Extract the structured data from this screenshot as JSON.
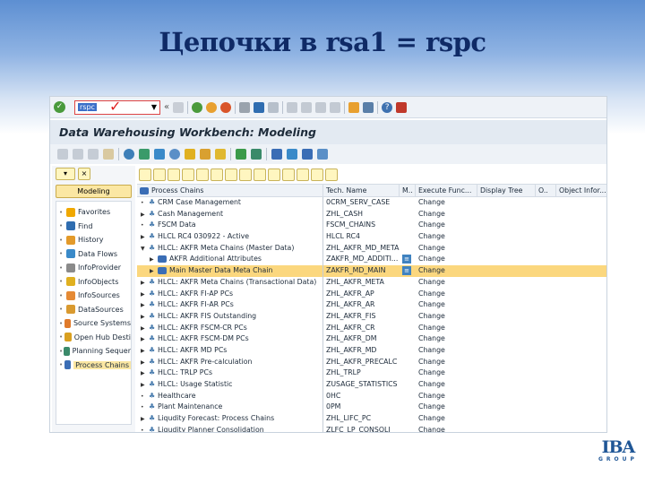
{
  "slide": {
    "title": "Цепочки в rsa1 = rspc",
    "logo": {
      "name": "IBA",
      "sub": "GROUP"
    }
  },
  "toolbar": {
    "command_value": "rspc",
    "check_mark": "✓"
  },
  "window": {
    "title": "Data Warehousing Workbench: Modeling"
  },
  "left": {
    "modeling_label": "Modeling",
    "items": [
      {
        "label": "Favorites",
        "color": "#f0a800"
      },
      {
        "label": "Find",
        "color": "#2f6db0"
      },
      {
        "label": "History",
        "color": "#e39a2a"
      },
      {
        "label": "Data Flows",
        "color": "#3a8ac9"
      },
      {
        "label": "InfoProvider",
        "color": "#8a8a8a"
      },
      {
        "label": "InfoObjects",
        "color": "#e0b020"
      },
      {
        "label": "InfoSources",
        "color": "#e58a35"
      },
      {
        "label": "DataSources",
        "color": "#d99a30"
      },
      {
        "label": "Source Systems",
        "color": "#e07a2a"
      },
      {
        "label": "Open Hub Desti",
        "color": "#d9a020"
      },
      {
        "label": "Planning Sequer",
        "color": "#3a8a6a"
      },
      {
        "label": "Process Chains",
        "color": "#3a6db5",
        "selected": true
      }
    ]
  },
  "tree": {
    "columns": [
      "Process Chains",
      "Tech. Name",
      "M..",
      "Execute Func...",
      "Display Tree",
      "O..",
      "Object Infor..."
    ],
    "rows": [
      {
        "name": "CRM Case Management",
        "tech": "0CRM_SERV_CASE",
        "exec": "Change",
        "expander": "leaf",
        "level": 0
      },
      {
        "name": "Cash Management",
        "tech": "ZHL_CASH",
        "exec": "Change",
        "expander": "collapsed",
        "level": 0
      },
      {
        "name": "FSCM Data",
        "tech": "FSCM_CHAINS",
        "exec": "Change",
        "expander": "leaf",
        "level": 0
      },
      {
        "name": "HLCL RC4 030922 - Active",
        "tech": "HLCL RC4",
        "exec": "Change",
        "expander": "collapsed",
        "level": 0
      },
      {
        "name": "HLCL: AKFR  Meta Chains (Master Data)",
        "tech": "ZHL_AKFR_MD_META",
        "exec": "Change",
        "expander": "expanded",
        "level": 0
      },
      {
        "name": "AKFR Additional Attributes",
        "tech": "ZAKFR_MD_ADDITI...",
        "exec": "Change",
        "expander": "collapsed",
        "level": 1,
        "meta": true
      },
      {
        "name": "Main Master Data Meta Chain",
        "tech": "ZAKFR_MD_MAIN",
        "exec": "Change",
        "expander": "collapsed",
        "level": 1,
        "meta": true,
        "selected": true
      },
      {
        "name": "HLCL: AKFR  Meta Chains (Transactional Data)",
        "tech": "ZHL_AKFR_META",
        "exec": "Change",
        "expander": "collapsed",
        "level": 0
      },
      {
        "name": "HLCL: AKFR FI-AP PCs",
        "tech": "ZHL_AKFR_AP",
        "exec": "Change",
        "expander": "collapsed",
        "level": 0
      },
      {
        "name": "HLCL: AKFR FI-AR PCs",
        "tech": "ZHL_AKFR_AR",
        "exec": "Change",
        "expander": "collapsed",
        "level": 0
      },
      {
        "name": "HLCL: AKFR FIS Outstanding",
        "tech": "ZHL_AKFR_FIS",
        "exec": "Change",
        "expander": "collapsed",
        "level": 0
      },
      {
        "name": "HLCL: AKFR FSCM-CR PCs",
        "tech": "ZHL_AKFR_CR",
        "exec": "Change",
        "expander": "collapsed",
        "level": 0
      },
      {
        "name": "HLCL: AKFR FSCM-DM PCs",
        "tech": "ZHL_AKFR_DM",
        "exec": "Change",
        "expander": "collapsed",
        "level": 0
      },
      {
        "name": "HLCL: AKFR MD PCs",
        "tech": "ZHL_AKFR_MD",
        "exec": "Change",
        "expander": "collapsed",
        "level": 0
      },
      {
        "name": "HLCL: AKFR Pre-calculation",
        "tech": "ZHL_AKFR_PRECALC",
        "exec": "Change",
        "expander": "collapsed",
        "level": 0
      },
      {
        "name": "HLCL: TRLP PCs",
        "tech": "ZHL_TRLP",
        "exec": "Change",
        "expander": "collapsed",
        "level": 0
      },
      {
        "name": "HLCL: Usage Statistic",
        "tech": "ZUSAGE_STATISTICS",
        "exec": "Change",
        "expander": "collapsed",
        "level": 0
      },
      {
        "name": "Healthcare",
        "tech": "0HC",
        "exec": "Change",
        "expander": "leaf",
        "level": 0
      },
      {
        "name": "Plant Maintenance",
        "tech": "0PM",
        "exec": "Change",
        "expander": "leaf",
        "level": 0
      },
      {
        "name": "Liqudity Forecast: Process Chains",
        "tech": "ZHL_LIFC_PC",
        "exec": "Change",
        "expander": "collapsed",
        "level": 0
      },
      {
        "name": "Liqudity Planner Consolidation",
        "tech": "ZLFC_LP_CONSOLI",
        "exec": "Change",
        "expander": "leaf",
        "level": 0
      }
    ]
  }
}
